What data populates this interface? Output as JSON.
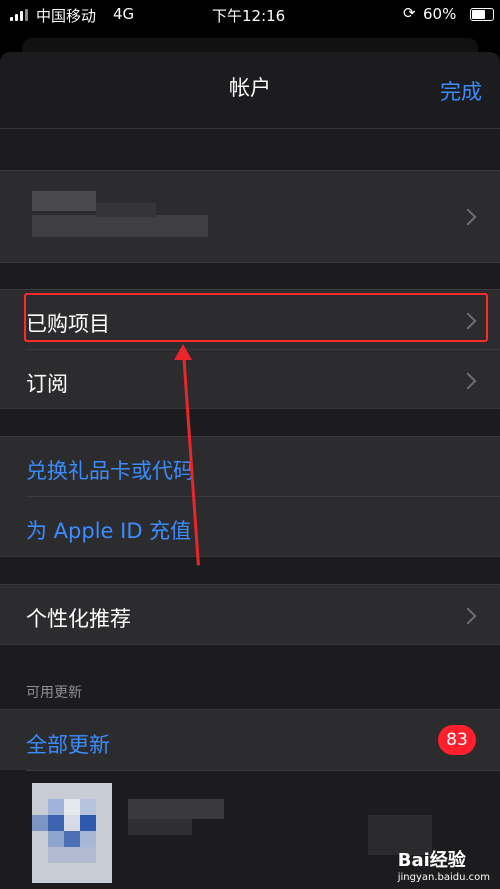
{
  "status_bar": {
    "carrier": "中国移动",
    "network": "4G",
    "time": "下午12:16",
    "battery": "60%"
  },
  "nav": {
    "title": "帐户",
    "done_label": "完成"
  },
  "account": {
    "name_redacted": "",
    "email_redacted": ""
  },
  "menu_group_1": [
    {
      "label": "已购项目"
    },
    {
      "label": "订阅"
    }
  ],
  "menu_group_2": [
    {
      "label": "兑换礼品卡或代码"
    },
    {
      "label": "为 Apple ID 充值"
    }
  ],
  "menu_group_3": [
    {
      "label": "个性化推荐"
    }
  ],
  "updates": {
    "section_header": "可用更新",
    "update_all_label": "全部更新",
    "count": "83"
  },
  "watermark": {
    "brand": "Bai经验",
    "site": "jingyan.baidu.com"
  },
  "colors": {
    "accent": "#3a8dff",
    "badge": "#ff1f2d",
    "highlight": "#ff2a2a"
  }
}
